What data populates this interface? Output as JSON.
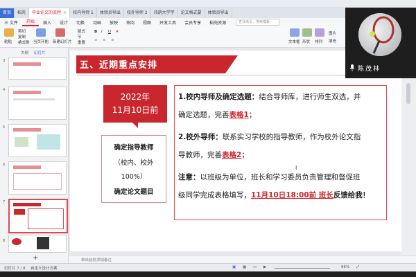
{
  "tabs": {
    "home": "首页",
    "items": [
      {
        "label": "稻壳"
      },
      {
        "label": "毕业论文的流程"
      },
      {
        "label": "校内导师 1"
      },
      {
        "label": "体验员导出"
      },
      {
        "label": "校外导师 2"
      },
      {
        "label": "鸿鹄大学学"
      },
      {
        "label": "论文格式要"
      },
      {
        "label": "体验员导出"
      }
    ],
    "active_index": 1
  },
  "menu": {
    "items": [
      "三 文件",
      "开始",
      "插入",
      "设计",
      "切换",
      "动画",
      "放映",
      "审阅",
      "视图",
      "开发工具",
      "会员专享",
      "稻壳资源"
    ],
    "active_index": 1,
    "search_placeholder": "查找命令、搜索模板"
  },
  "ribbon": {
    "paste": "粘贴",
    "cut": "剪切",
    "copy": "复制",
    "format_painter": "格式刷",
    "from_current": "当页开始",
    "new_slide": "新建幻灯片",
    "layout": "版式",
    "section": "节",
    "reset": "重置",
    "text_box": "文本框",
    "shape": "形状",
    "arrange": "排列",
    "picture": "图片",
    "fill": "填充"
  },
  "left_panel": {
    "tab_outline": "大纲",
    "tab_slides": "幻灯片",
    "slide_numbers": [
      "3",
      "4",
      "5",
      "6",
      "7",
      "8"
    ]
  },
  "slide": {
    "title": "五、近期重点安排",
    "date_year": "2022年",
    "date_day": "11月10日前",
    "task_line1": "确定指导教师",
    "task_line2": "（校内、校外",
    "task_line3": "100%）",
    "task_line4": "确定论文题目",
    "p1_head": "1.校内导师及确定选题：",
    "p1_text": "结合导师库，进行师生双选，并",
    "p1_text2": "确定选题，完善",
    "p1_table": "表格1",
    "p1_end": "；",
    "p2_head": "2.校外导师：",
    "p2_text": "联系实习学校的指导教师，作为校外论文指",
    "p2_text2": "导教师，完善",
    "p2_table": "表格2",
    "p2_end": "；",
    "note_head": "注意：",
    "note_text": "以班级为单位，班长和学习委员负责管理和督促班",
    "note_text2": "级同学完成表格填写，",
    "note_deadline": "11月10日18:00前 班长",
    "note_end": "反馈给我！"
  },
  "notes_placeholder": "单击此处添加备注",
  "status": {
    "slide_pos": "幻灯片 7 / 8",
    "theme": "自定义设计方案",
    "zoom": "96%"
  },
  "video": {
    "name": "陈茂林"
  },
  "colors": {
    "accent_red": "#c9272d",
    "wps_blue": "#3d6fd6"
  }
}
